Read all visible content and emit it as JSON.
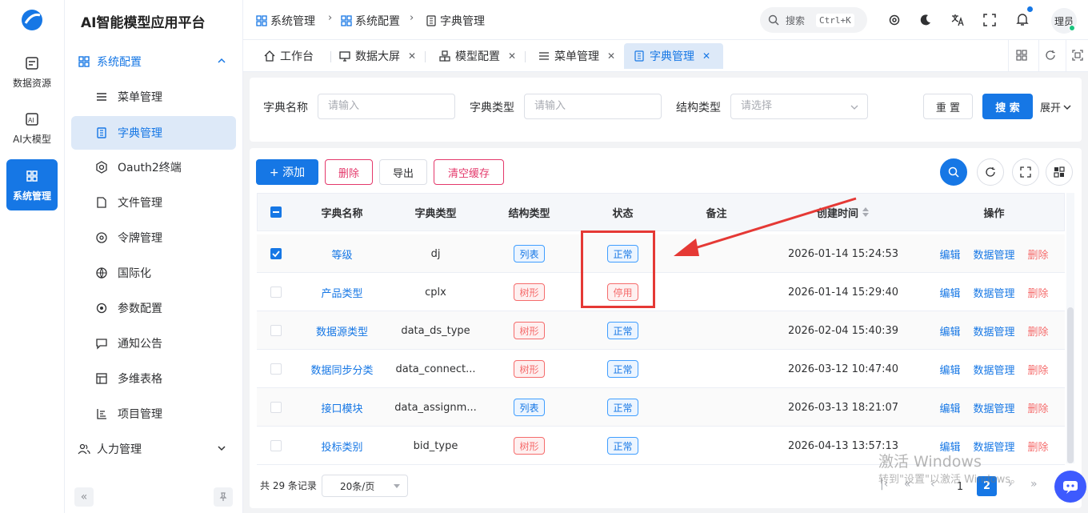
{
  "app": {
    "title": "AI智能模型应用平台"
  },
  "rail": [
    {
      "label": "数据资源",
      "icon": "data-icon"
    },
    {
      "label": "AI大模型",
      "icon": "ai-icon"
    },
    {
      "label": "系统管理",
      "icon": "grid-icon"
    }
  ],
  "menu": {
    "group": "系统配置",
    "items": [
      "菜单管理",
      "字典管理",
      "Oauth2终端",
      "文件管理",
      "令牌管理",
      "国际化",
      "参数配置",
      "通知公告",
      "多维表格",
      "项目管理"
    ],
    "group2": "人力管理"
  },
  "breadcrumb": [
    "系统管理",
    "系统配置",
    "字典管理"
  ],
  "header": {
    "search_placeholder": "搜索",
    "shortcut": "Ctrl+K",
    "user": "理员"
  },
  "tabs": [
    {
      "label": "工作台"
    },
    {
      "label": "数据大屏"
    },
    {
      "label": "模型配置"
    },
    {
      "label": "菜单管理"
    },
    {
      "label": "字典管理"
    }
  ],
  "filters": {
    "name_label": "字典名称",
    "name_placeholder": "请输入",
    "type_label": "字典类型",
    "type_placeholder": "请输入",
    "struct_label": "结构类型",
    "struct_placeholder": "请选择",
    "reset": "重 置",
    "search": "搜 索",
    "expand": "展开"
  },
  "toolbar": {
    "add": "+ 添加",
    "delete": "删除",
    "export": "导出",
    "clear": "清空缓存"
  },
  "table": {
    "columns": [
      "字典名称",
      "字典类型",
      "结构类型",
      "状态",
      "备注",
      "创建时间",
      "操作"
    ],
    "actions": [
      "编辑",
      "数据管理",
      "删除"
    ],
    "rows": [
      {
        "name": "等级",
        "type": "dj",
        "struct": "列表",
        "status": "正常",
        "time": "2026-01-14 15:24:53",
        "checked": true
      },
      {
        "name": "产品类型",
        "type": "cplx",
        "struct": "树形",
        "status": "停用",
        "time": "2026-01-14 15:29:40",
        "checked": false
      },
      {
        "name": "数据源类型",
        "type": "data_ds_type",
        "struct": "树形",
        "status": "正常",
        "time": "2026-02-04 15:40:39",
        "checked": false
      },
      {
        "name": "数据同步分类",
        "type": "data_connect...",
        "struct": "树形",
        "status": "正常",
        "time": "2026-03-12 10:47:40",
        "checked": false
      },
      {
        "name": "接口模块",
        "type": "data_assignm...",
        "struct": "列表",
        "status": "正常",
        "time": "2026-03-13 18:21:07",
        "checked": false
      },
      {
        "name": "投标类别",
        "type": "bid_type",
        "struct": "树形",
        "status": "正常",
        "time": "2026-04-13 13:57:13",
        "checked": false
      }
    ]
  },
  "pagination": {
    "total": "共 29 条记录",
    "page_size": "20条/页",
    "pages": [
      "1",
      "2"
    ],
    "current": "2"
  },
  "watermark": {
    "line1": "激活 Windows",
    "line2": "转到\"设置\"以激活 Windows。"
  }
}
